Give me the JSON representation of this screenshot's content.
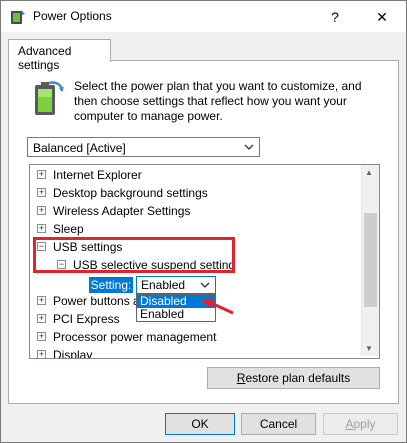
{
  "window": {
    "title": "Power Options",
    "help_glyph": "?",
    "close_glyph": "✕"
  },
  "tabs": [
    {
      "label": "Advanced settings"
    }
  ],
  "description": "Select the power plan that you want to customize, and then choose settings that reflect how you want your computer to manage power.",
  "plan": {
    "selected": "Balanced [Active]"
  },
  "tree": {
    "items": [
      {
        "label": "Internet Explorer",
        "expander": "+"
      },
      {
        "label": "Desktop background settings",
        "expander": "+"
      },
      {
        "label": "Wireless Adapter Settings",
        "expander": "+"
      },
      {
        "label": "Sleep",
        "expander": "+"
      },
      {
        "label": "USB settings",
        "expander": "−"
      },
      {
        "label": "USB selective suspend setting",
        "expander": "−"
      },
      {
        "label": "Power buttons and lid",
        "expander": "+"
      },
      {
        "label": "PCI Express",
        "expander": "+"
      },
      {
        "label": "Processor power management",
        "expander": "+"
      },
      {
        "label": "Display",
        "expander": "+"
      }
    ],
    "setting_label": "Setting:",
    "setting_value": "Enabled",
    "dropdown_options": [
      "Disabled",
      "Enabled"
    ]
  },
  "buttons": {
    "restore_prefix": "R",
    "restore_rest": "estore plan defaults",
    "ok": "OK",
    "cancel": "Cancel",
    "apply_prefix": "A",
    "apply_rest": "pply"
  },
  "colors": {
    "highlight": "#e0242c",
    "selection": "#0078d7"
  }
}
